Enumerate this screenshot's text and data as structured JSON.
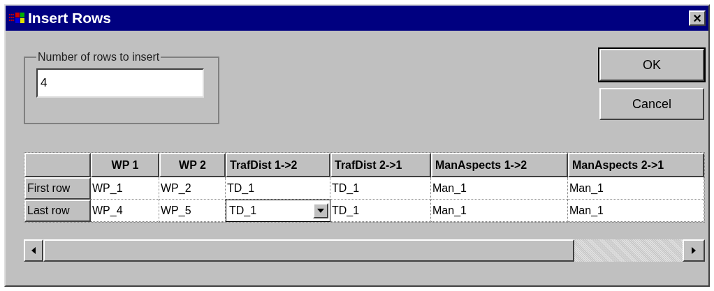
{
  "window": {
    "title": "Insert Rows",
    "close": "×"
  },
  "rows_group": {
    "label": "Number of rows to insert",
    "value": "4"
  },
  "buttons": [
    {
      "label": "OK",
      "default": true
    },
    {
      "label": "Cancel",
      "default": false
    }
  ],
  "table": {
    "columns": [
      "WP 1",
      "WP 2",
      "TrafDist 1->2",
      "TrafDist 2->1",
      "ManAspects 1->2",
      "ManAspects 2->1"
    ],
    "rows": [
      {
        "header": "First row",
        "cells": [
          {
            "kind": "text",
            "value": "WP_1"
          },
          {
            "kind": "text",
            "value": "WP_2"
          },
          {
            "kind": "text",
            "value": "TD_1"
          },
          {
            "kind": "text",
            "value": "TD_1"
          },
          {
            "kind": "text",
            "value": "Man_1"
          },
          {
            "kind": "text",
            "value": "Man_1"
          }
        ]
      },
      {
        "header": "Last row",
        "cells": [
          {
            "kind": "text",
            "value": "WP_4"
          },
          {
            "kind": "text",
            "value": "WP_5"
          },
          {
            "kind": "dropdown",
            "value": "TD_1"
          },
          {
            "kind": "text",
            "value": "TD_1"
          },
          {
            "kind": "text",
            "value": "Man_1"
          },
          {
            "kind": "text",
            "value": "Man_1"
          }
        ]
      }
    ]
  }
}
